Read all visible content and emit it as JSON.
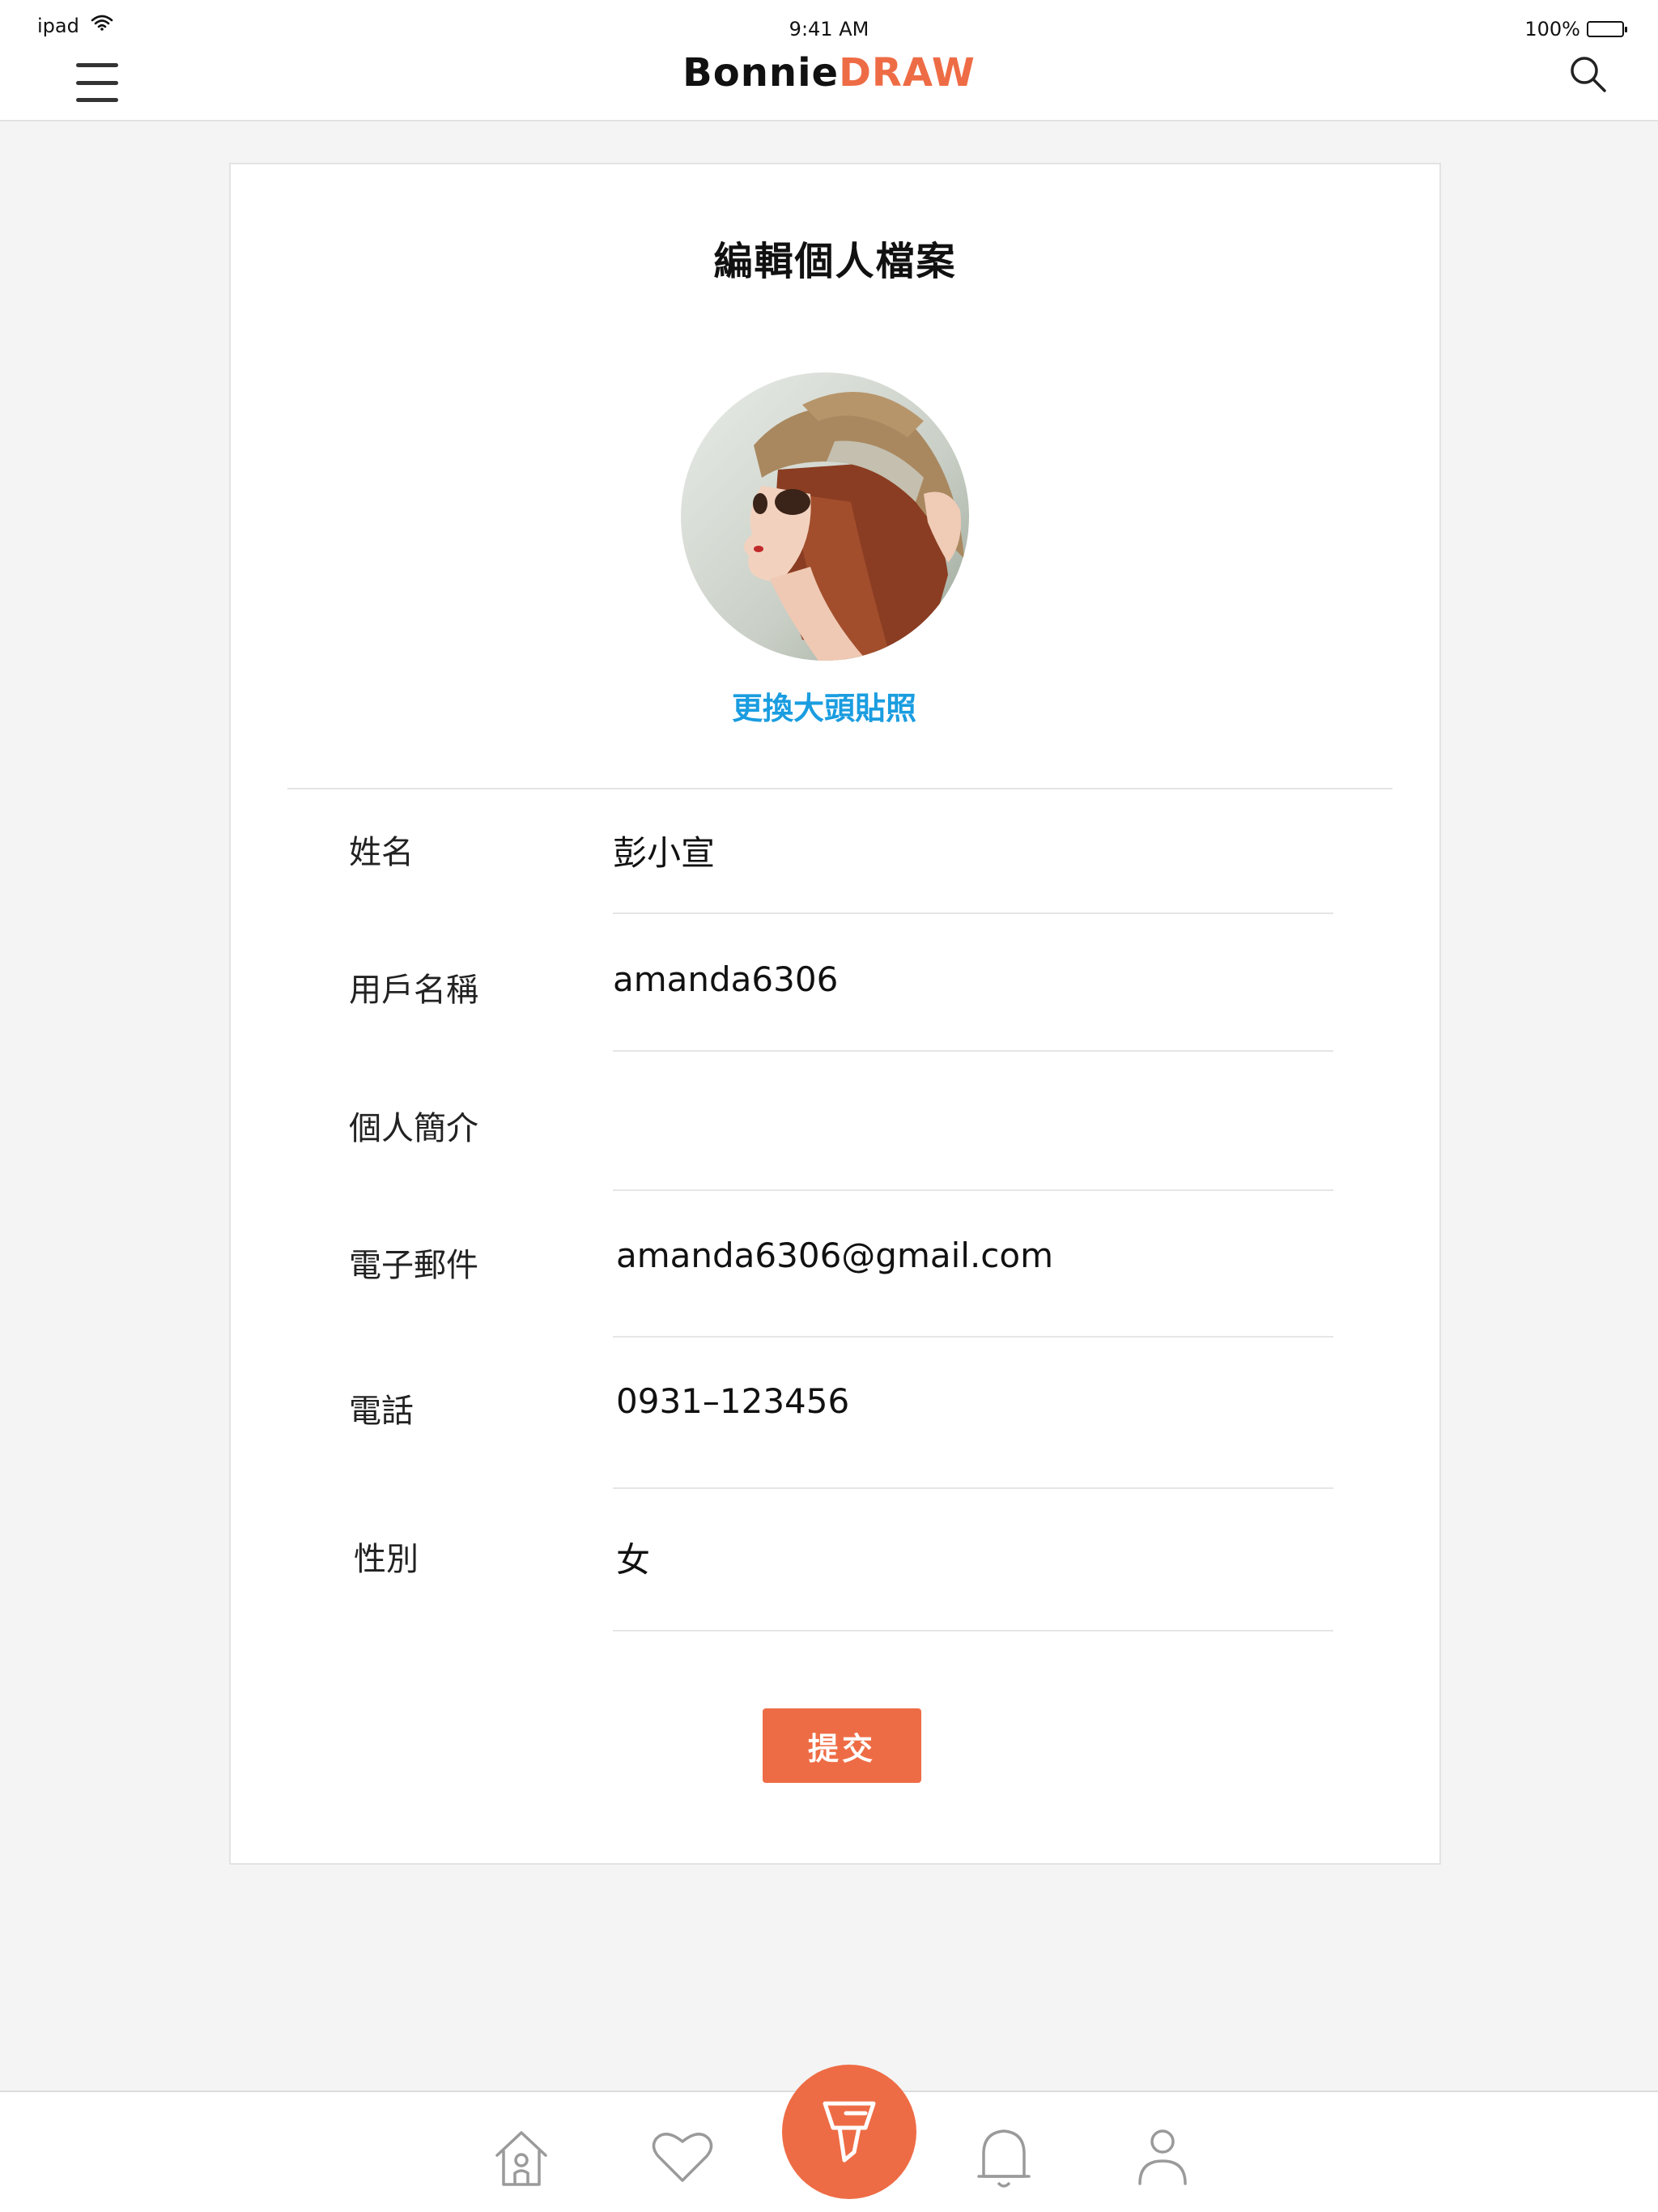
{
  "status_bar": {
    "device": "ipad",
    "time": "9:41 AM",
    "battery": "100%"
  },
  "header": {
    "logo_part1": "Bonnie",
    "logo_part2": "DRAW",
    "menu_icon": "hamburger-icon",
    "search_icon": "search-icon"
  },
  "form": {
    "title": "編輯個人檔案",
    "change_photo": "更換大頭貼照",
    "fields": [
      {
        "label": "姓名",
        "value": "彭小宣"
      },
      {
        "label": "用戶名稱",
        "value": "amanda6306"
      },
      {
        "label": "個人簡介",
        "value": ""
      },
      {
        "label": "電子郵件",
        "value": "amanda6306@gmail.com"
      },
      {
        "label": "電話",
        "value": "0931–123456"
      },
      {
        "label": "性別",
        "value": "女"
      }
    ],
    "submit": "提交"
  },
  "bottom_nav": {
    "items": [
      "home-icon",
      "heart-icon",
      "brush-icon",
      "bell-icon",
      "person-icon"
    ],
    "accent": "#ee6c45"
  },
  "colors": {
    "accent": "#ee6c45",
    "link": "#1a9de0",
    "background": "#f4f4f4"
  }
}
